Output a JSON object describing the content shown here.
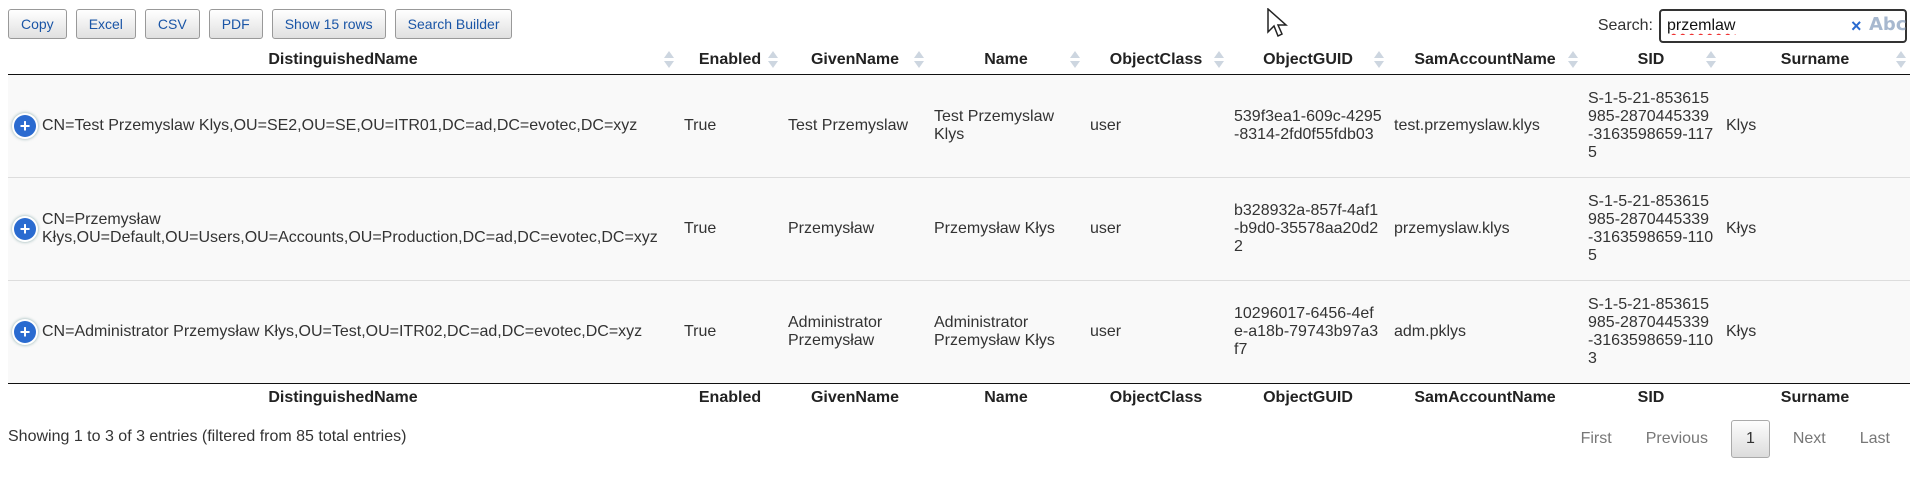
{
  "toolbar": {
    "copy_label": "Copy",
    "excel_label": "Excel",
    "csv_label": "CSV",
    "pdf_label": "PDF",
    "rows_label": "Show 15 rows",
    "search_builder_label": "Search Builder"
  },
  "search": {
    "label": "Search:",
    "value": "przemlaw",
    "clear_glyph": "×",
    "spell_glyph": "Abc"
  },
  "columns": [
    "DistinguishedName",
    "Enabled",
    "GivenName",
    "Name",
    "ObjectClass",
    "ObjectGUID",
    "SamAccountName",
    "SID",
    "Surname"
  ],
  "rows": [
    {
      "dn": "CN=Test Przemyslaw Klys,OU=SE2,OU=SE,OU=ITR01,DC=ad,DC=evotec,DC=xyz",
      "enabled": "True",
      "given": "Test Przemyslaw",
      "name": "Test Przemyslaw Klys",
      "objclass": "user",
      "guid": "539f3ea1-609c-4295-8314-2fd0f55fdb03",
      "sam": "test.przemyslaw.klys",
      "sid": "S-1-5-21-853615985-2870445339-3163598659-1175",
      "surname": "Klys"
    },
    {
      "dn": "CN=Przemysław Kłys,OU=Default,OU=Users,OU=Accounts,OU=Production,DC=ad,DC=evotec,DC=xyz",
      "enabled": "True",
      "given": "Przemysław",
      "name": "Przemysław Kłys",
      "objclass": "user",
      "guid": "b328932a-857f-4af1-b9d0-35578aa20d22",
      "sam": "przemyslaw.klys",
      "sid": "S-1-5-21-853615985-2870445339-3163598659-1105",
      "surname": "Kłys"
    },
    {
      "dn": "CN=Administrator Przemysław Kłys,OU=Test,OU=ITR02,DC=ad,DC=evotec,DC=xyz",
      "enabled": "True",
      "given": "Administrator Przemysław",
      "name": "Administrator Przemysław Kłys",
      "objclass": "user",
      "guid": "10296017-6456-4efe-a18b-79743b97a3f7",
      "sam": "adm.pklys",
      "sid": "S-1-5-21-853615985-2870445339-3163598659-1103",
      "surname": "Kłys"
    }
  ],
  "info": "Showing 1 to 3 of 3 entries (filtered from 85 total entries)",
  "pager": {
    "first": "First",
    "previous": "Previous",
    "current": "1",
    "next": "Next",
    "last": "Last"
  },
  "icons": {
    "expand": "plus-icon",
    "clear": "clear-icon",
    "spell": "spellcheck-icon",
    "cursor": "mouse-cursor-icon"
  },
  "colors": {
    "accent": "#2a6bd0",
    "button_text": "#1a55a6",
    "row_bg": "#f9f9f9"
  }
}
